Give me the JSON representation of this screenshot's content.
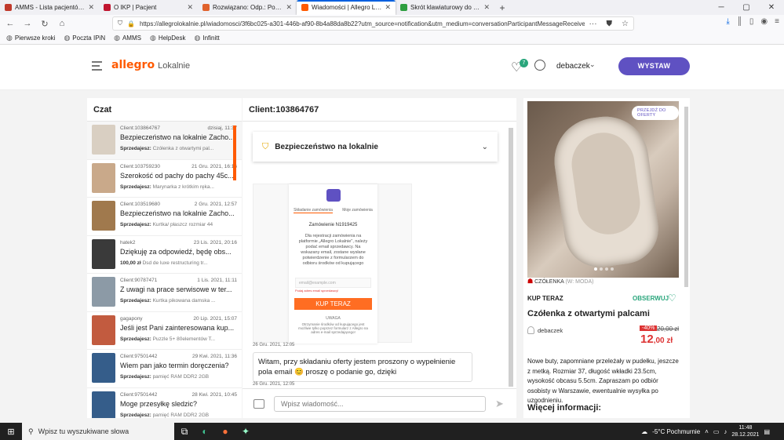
{
  "tabs": [
    {
      "title": "AMMS - Lista pacjentów - Klini",
      "color": "#c0392b"
    },
    {
      "title": "O IKP | Pacjent",
      "color": "#c0152f"
    },
    {
      "title": "Rozwiązano: Odp.: Potwierdzen",
      "color": "#e0622c"
    },
    {
      "title": "Wiadomości | Allegro Lokalnie",
      "color": "#ff5a00",
      "active": true
    },
    {
      "title": "Skrót klawiaturowy do funkcji P",
      "color": "#2e9e3f"
    }
  ],
  "url": "https://allegrolokalnie.pl/wiadomosci/3f6bc025-a301-446b-af90-8b4a88da8b22?utm_source=notification&utm_medium=conversationParticipantMessageReceived&utm_camp",
  "bookmarks": [
    "Pierwsze kroki",
    "Poczta IPiN",
    "AMMS",
    "HelpDesk",
    "Infinitt"
  ],
  "header": {
    "logo_main": "allegro",
    "logo_sub": "Lokalnie",
    "fav_count": "7",
    "username": "debaczek",
    "wystaw": "WYSTAW"
  },
  "chat_list": {
    "title": "Czat",
    "items": [
      {
        "client": "Client:103864767",
        "date": "dzisiaj, 11:37",
        "subject": "Bezpieczeństwo na lokalnie Zacho...",
        "seller_label": "Sprzedajesz:",
        "item": "Czółenka z otwartymi pal...",
        "thumb": "#d9cfc2"
      },
      {
        "client": "Client:103759230",
        "date": "21 Gru. 2021, 16:16",
        "subject": "Szerokość od pachy do pachy 45c...",
        "seller_label": "Sprzedajesz:",
        "item": "Marynarka z krótkim ręka...",
        "thumb": "#c9a98a"
      },
      {
        "client": "Client:103519680",
        "date": "2 Gru. 2021, 12:57",
        "subject": "Bezpieczeństwo na lokalnie Zacho...",
        "seller_label": "Sprzedajesz:",
        "item": "Kurtka/ płaszcz rozmiar 44",
        "thumb": "#a0794d"
      },
      {
        "client": "hatek2",
        "date": "23 Lis. 2021, 20:16",
        "subject": "Dziękuję za odpowiedź, będę obs...",
        "seller_label": "100,00 zł",
        "item": "Dsd de luxe restructuring tr...",
        "thumb": "#3a3a3a"
      },
      {
        "client": "Client:90787471",
        "date": "1 Lis. 2021, 11:11",
        "subject": "Z uwagi na prace serwisowe w ter...",
        "seller_label": "Sprzedajesz:",
        "item": "Kurtka pikowana damska ...",
        "thumb": "#8c9aa6"
      },
      {
        "client": "gagapony",
        "date": "20 Lip. 2021, 15:07",
        "subject": "Jeśli jest Pani zainteresowana kup...",
        "seller_label": "Sprzedajesz:",
        "item": "Puzzle 5+ 80elementów T...",
        "thumb": "#c25b3f"
      },
      {
        "client": "Client:97501442",
        "date": "29 Kwi. 2021, 11:36",
        "subject": "Wiem pan jako termin doręczenia?",
        "seller_label": "Sprzedajesz:",
        "item": "pamięć RAM DDR2 2GB",
        "thumb": "#355d8a"
      },
      {
        "client": "Client:97501442",
        "date": "28 Kwi. 2021, 10:45",
        "subject": "Moge przesyłkę sledzic?",
        "seller_label": "Sprzedajesz:",
        "item": "pamięć RAM DDR2 2GB",
        "thumb": "#355d8a"
      }
    ]
  },
  "conversation": {
    "title": "Client:103864767",
    "security_label": "Bezpieczeństwo na lokalnie",
    "phone": {
      "tab1": "Składanie zamówienia",
      "tab2": "Moje zamówienia",
      "order": "Zamówienie N1919425",
      "text": "Dla rejestracji zamówienia na platformie „Allegro Lokalnie\", należy podać email sprzedawcy. Na wskazany email, zostane wysłane potwierdzenie z formularzem do odbioru środków od kupującego",
      "email_placeholder": "email@example.com",
      "error": "Podaj adres email sprzedawcy!",
      "button": "KUP TERAZ",
      "uwaga": "UWAGA",
      "uwaga_text": "Otrzymanie środków od kupującego jest możliwe tylko poprzez formularz z Allegro na adres e-mail sprzedającego!"
    },
    "ts1": "26 Gru. 2021, 12:05",
    "message": "Witam, przy składaniu oferty jestem proszony o wypełnienie pola email 😊 proszę o podanie go, dzięki",
    "ts2": "26 Gru. 2021, 12:05",
    "input_placeholder": "Wpisz wiadomość..."
  },
  "product": {
    "badge": "PRZEJDŹ DO OFERTY",
    "category": "CZÓŁENKA",
    "category_sub": "(W: MODA)",
    "kup_teraz": "KUP TERAZ",
    "obserwuj": "OBSERWUJ",
    "title": "Czółenka z otwartymi palcami",
    "seller": "debaczek",
    "discount": "-40%",
    "old_price": "20,00 zł",
    "price_main": "12",
    "price_rest": ",00 zł",
    "description": "Nowe buty, zapomniane przeleżały w pudełku, jeszcze z metką. Rozmiar 37, długość wkładki 23.5cm, wysokość obcasu 5.5cm. Zapraszam po odbiór osobisty w Warszawie, ewentualnie wysyłka po uzgodnieniu.",
    "more": "Więcej informacji:"
  },
  "taskbar": {
    "search": "Wpisz tu wyszukiwane słowa",
    "weather": "-5°C  Pochmurnie",
    "time": "11:48",
    "date": "28.12.2021"
  }
}
